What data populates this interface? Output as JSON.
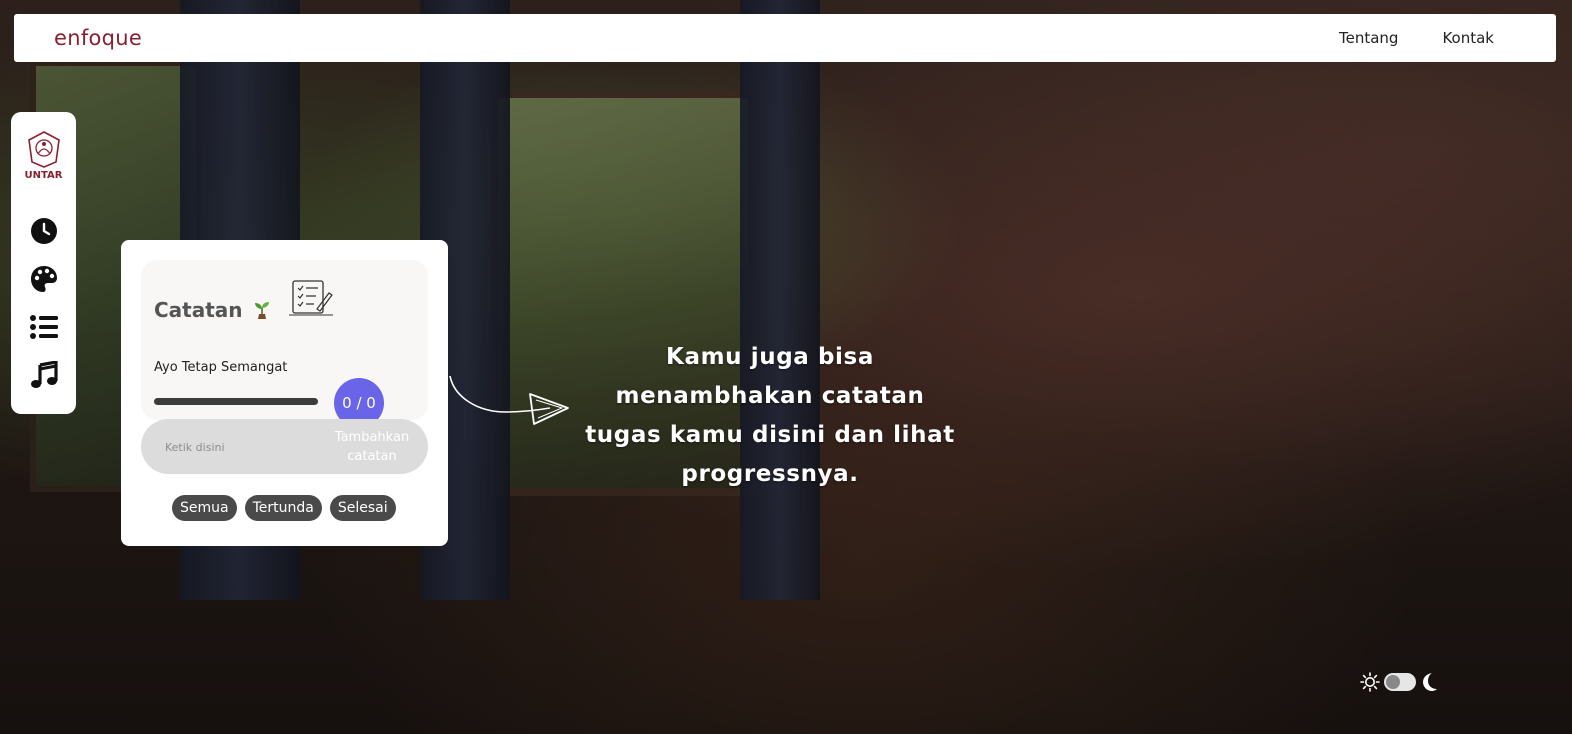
{
  "navbar": {
    "brand": "enfoque",
    "links": [
      "Tentang",
      "Kontak"
    ]
  },
  "sidebar": {
    "logo_text": "UNTAR",
    "items": [
      {
        "icon": "clock-icon"
      },
      {
        "icon": "palette-icon"
      },
      {
        "icon": "list-icon"
      },
      {
        "icon": "music-icon"
      }
    ]
  },
  "notes": {
    "title": "Catatan",
    "motto": "Ayo Tetap Semangat",
    "counter": "0 / 0",
    "progress": 0,
    "input_placeholder": "Ketik disini",
    "add_label": "Tambahkan catatan",
    "filters": [
      "Semua",
      "Tertunda",
      "Selesai"
    ]
  },
  "hint": {
    "text": "Kamu juga bisa menambhakan catatan tugas kamu disini dan lihat progressnya."
  },
  "theme": {
    "accent": "#6a64e8",
    "brand_color": "#8a2030",
    "mode": "light"
  }
}
